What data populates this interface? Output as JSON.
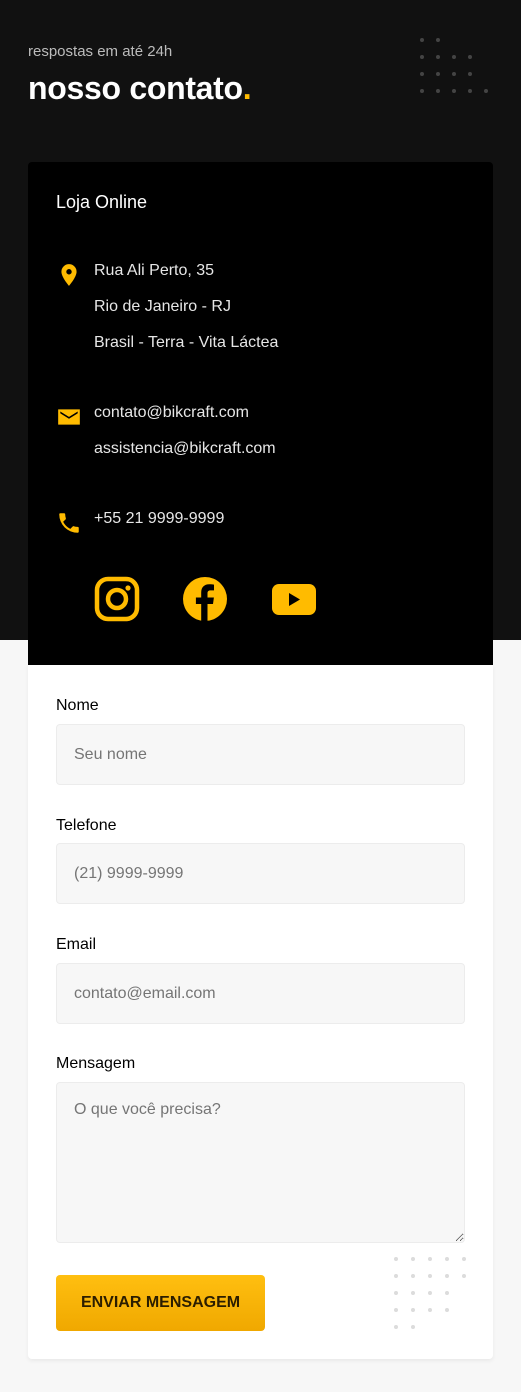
{
  "hero": {
    "subtitle": "respostas em até 24h",
    "title": "nosso contato",
    "title_dot": "."
  },
  "info_card": {
    "title": "Loja Online",
    "address": [
      "Rua Ali Perto, 35",
      "Rio de Janeiro - RJ",
      "Brasil - Terra - Vita Láctea"
    ],
    "emails": [
      "contato@bikcraft.com",
      "assistencia@bikcraft.com"
    ],
    "phone": "+55 21 9999-9999",
    "accent_color": "#ffbb00",
    "icons": [
      "location-pin-icon",
      "mail-icon",
      "phone-icon"
    ],
    "social": [
      "instagram-icon",
      "facebook-icon",
      "youtube-icon"
    ]
  },
  "form": {
    "fields": [
      {
        "label": "Nome",
        "placeholder": "Seu nome"
      },
      {
        "label": "Telefone",
        "placeholder": "(21) 9999-9999"
      },
      {
        "label": "Email",
        "placeholder": "contato@email.com"
      },
      {
        "label": "Mensagem",
        "placeholder": "O que você precisa?"
      }
    ],
    "submit_label": "ENVIAR MENSAGEM"
  }
}
